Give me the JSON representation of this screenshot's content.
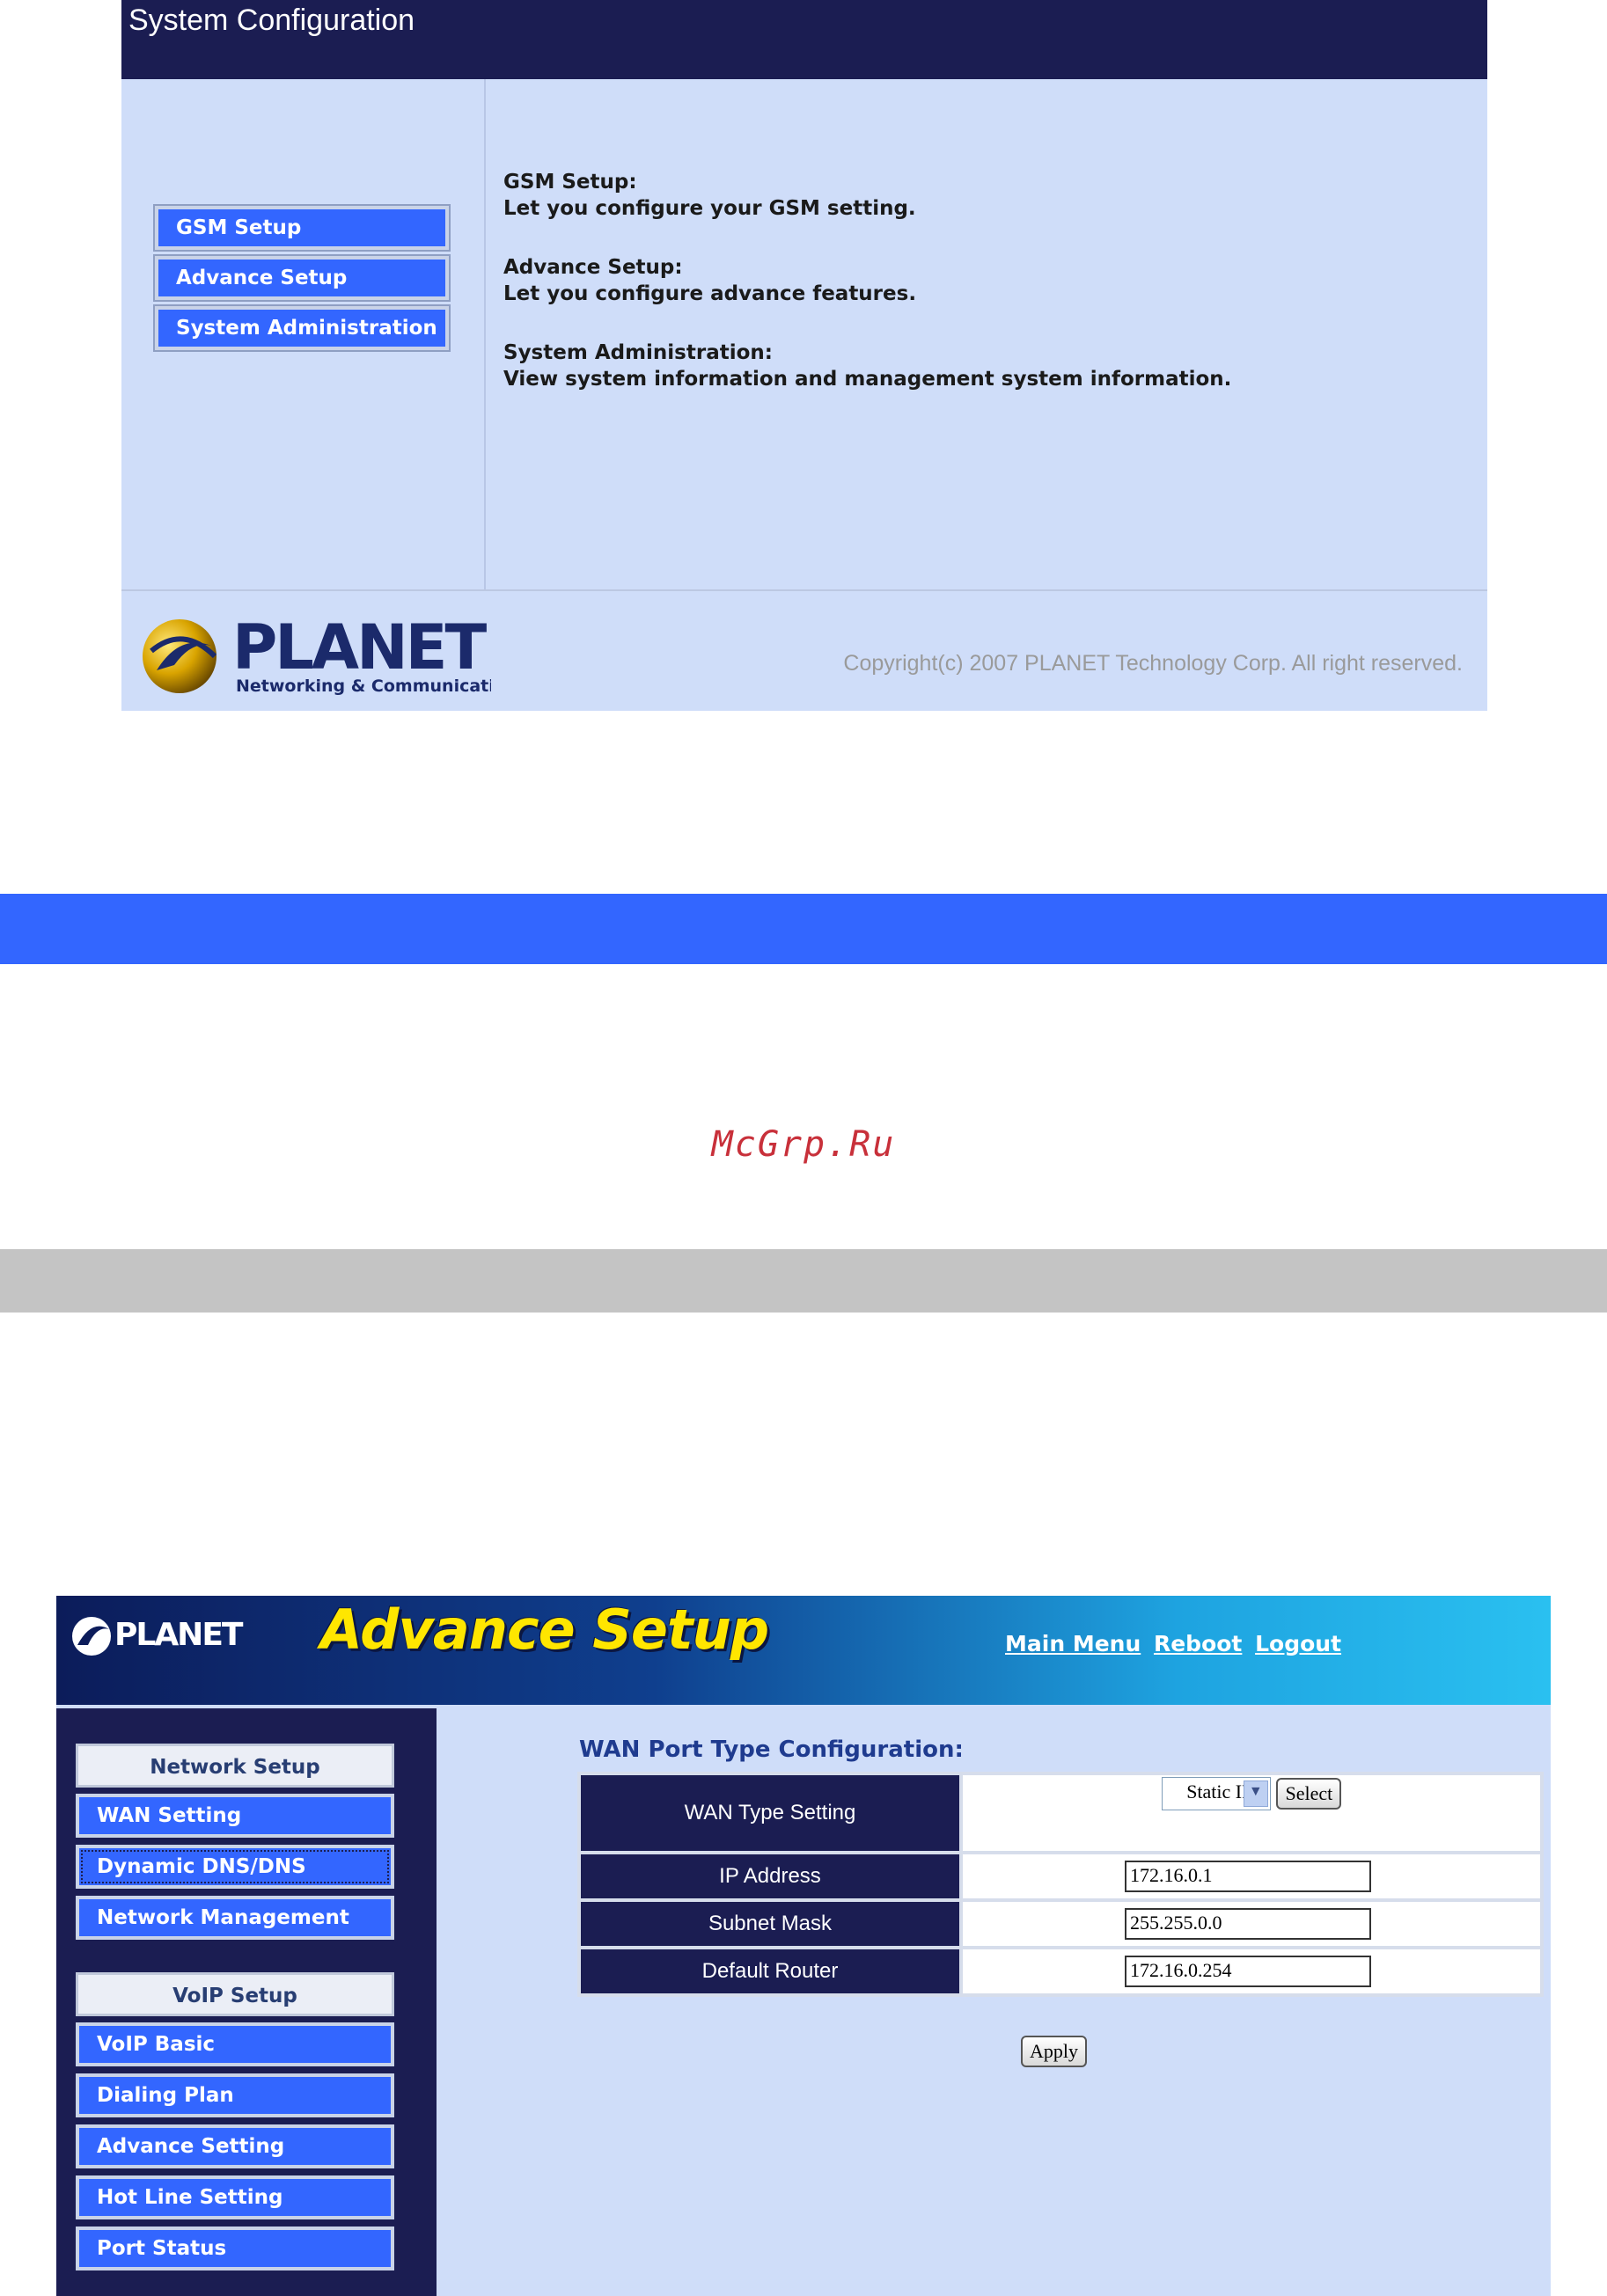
{
  "system_config": {
    "title": "System Configuration",
    "menu": [
      "GSM Setup",
      "Advance Setup",
      "System Administration"
    ],
    "descriptions": [
      {
        "heading": "GSM Setup:",
        "text": "Let you configure your GSM setting."
      },
      {
        "heading": "Advance Setup:",
        "text": "Let you configure advance features."
      },
      {
        "heading": "System Administration:",
        "text": "View system information and management system information."
      }
    ],
    "logo": {
      "name": "PLANET",
      "tagline": "Networking & Communication"
    },
    "copyright": "Copyright(c) 2007 PLANET Technology Corp. All right reserved."
  },
  "watermark": "McGrp.Ru",
  "advance_setup": {
    "header": {
      "logo": "PLANET",
      "title": "Advance Setup",
      "links": [
        "Main Menu",
        "Reboot",
        "Logout"
      ]
    },
    "sidebar": {
      "network_group": "Network Setup",
      "network_items": [
        "WAN Setting",
        "Dynamic DNS/DNS",
        "Network Management"
      ],
      "voip_group": "VoIP Setup",
      "voip_items": [
        "VoIP Basic",
        "Dialing Plan",
        "Advance Setting",
        "Hot Line Setting",
        "Port Status"
      ]
    },
    "section_title": "WAN Port Type Configuration:",
    "form": {
      "wan_type_label": "WAN Type Setting",
      "wan_type_value": "Static IP",
      "select_button": "Select",
      "ip_label": "IP Address",
      "ip_value": "172.16.0.1",
      "mask_label": "Subnet Mask",
      "mask_value": "255.255.0.0",
      "router_label": "Default Router",
      "router_value": "172.16.0.254",
      "apply_button": "Apply"
    }
  },
  "colors": {
    "navy": "#1b1d52",
    "button_blue": "#3366ff",
    "panel_bg": "#cfddf9",
    "watermark_red": "#c8303a"
  }
}
